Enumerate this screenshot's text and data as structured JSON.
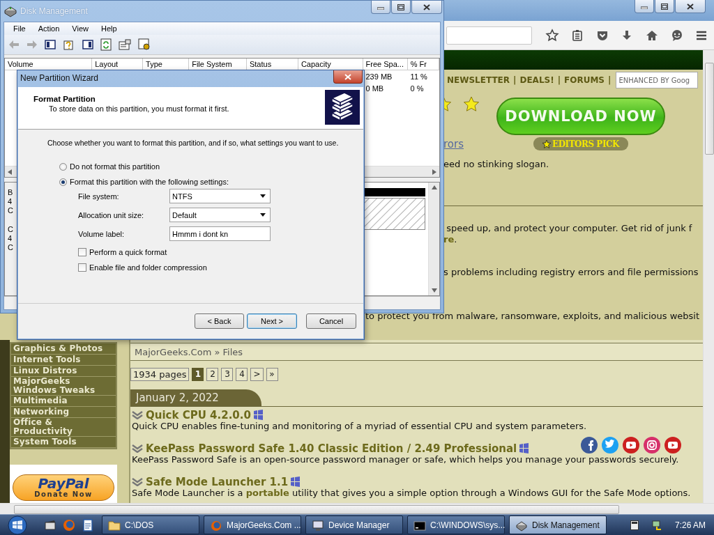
{
  "browser": {
    "nav_links": [
      "NEWSLETTER",
      "DEALS!",
      "FORUMS"
    ],
    "nav_separator": "|",
    "search": {
      "placeholder": "ENHANCED BY Goog"
    },
    "download_button": "DOWNLOAD NOW",
    "editors_pick": "EDITORS PICK",
    "link_fragment": "rors",
    "slogan_fragment": "eed no stinking slogan.",
    "feature_texts": [
      " speed up, and protect your computer. Get rid of junk f",
      "**re**.",
      "s problems including registry errors and file permissions",
      "to protect you from malware, ransomware, exploits, and malicious websit"
    ],
    "sidebar_items": [
      "Graphics & Photos",
      "Internet Tools",
      "Linux Distros",
      "MajorGeeks Windows Tweaks",
      "Multimedia",
      "Networking",
      "Office & Productivity",
      "System Tools"
    ],
    "donate": {
      "brand": "PayPal",
      "label": "Donate Now"
    },
    "breadcrumb": "MajorGeeks.Com » Files",
    "pagination": {
      "count": "1934 pages",
      "pages": [
        {
          "label": "1",
          "selected": true
        },
        {
          "label": "2",
          "selected": false
        },
        {
          "label": "3",
          "selected": false
        },
        {
          "label": "4",
          "selected": false
        },
        {
          "label": ">",
          "selected": false
        },
        {
          "label": "»",
          "selected": false
        }
      ]
    },
    "date": "January 2, 2022",
    "entries": [
      {
        "title": "Quick CPU 4.2.0.0",
        "description": "Quick CPU enables fine-tuning and monitoring of a myriad of essential CPU and system parameters."
      },
      {
        "title": "KeePass Password Safe 1.40 Classic Edition / 2.49 Professional",
        "description": "KeePass Password Safe is an open-source password manager or safe, which helps you manage your passwords securely."
      },
      {
        "title": "Safe Mode Launcher 1.1",
        "description": "Safe Mode Launcher is a **portable** utility that gives you a simple option through a Windows GUI for the Safe Mode options."
      }
    ]
  },
  "disk_management": {
    "title": "Disk Management",
    "menu": [
      "File",
      "Action",
      "View",
      "Help"
    ],
    "columns": [
      "Volume",
      "Layout",
      "Type",
      "File System",
      "Status",
      "Capacity",
      "Free Spa...",
      "% Fr"
    ],
    "rows": [
      {
        "free_space": "239 MB",
        "percent_free": "11 %"
      },
      {
        "free_space": "0 MB",
        "percent_free": "0 %"
      }
    ],
    "disk_labels": [
      [
        "B",
        "4",
        "C"
      ],
      [
        "C",
        "4",
        "C"
      ]
    ]
  },
  "wizard": {
    "title": "New Partition Wizard",
    "heading": "Format Partition",
    "subheading": "To store data on this partition, you must format it first.",
    "prompt": "Choose whether you want to format this partition, and if so, what settings you want to use.",
    "options": [
      {
        "label": "Do not format this partition",
        "selected": false
      },
      {
        "label": "Format this partition with the following settings:",
        "selected": true
      }
    ],
    "fields": [
      {
        "label": "File system:",
        "kind": "dropdown",
        "value": "NTFS"
      },
      {
        "label": "Allocation unit size:",
        "kind": "dropdown",
        "value": "Default"
      },
      {
        "label": "Volume label:",
        "kind": "text",
        "value": "Hmmm i dont kn"
      }
    ],
    "checkboxes": [
      {
        "label": "Perform a quick format",
        "checked": false
      },
      {
        "label": "Enable file and folder compression",
        "checked": false
      }
    ],
    "buttons": [
      "< Back",
      "Next >",
      "Cancel"
    ]
  },
  "taskbar": {
    "items": [
      {
        "label": "C:\\DOS",
        "kind": "folder",
        "selected": false
      },
      {
        "label": "MajorGeeks.Com ...",
        "kind": "browser",
        "selected": false
      },
      {
        "label": "Device Manager",
        "kind": "computer",
        "selected": false
      },
      {
        "label": "C:\\WINDOWS\\sys...",
        "kind": "console",
        "selected": false
      },
      {
        "label": "Disk Management",
        "kind": "disk",
        "selected": true
      }
    ],
    "clock": "7:26 AM"
  }
}
